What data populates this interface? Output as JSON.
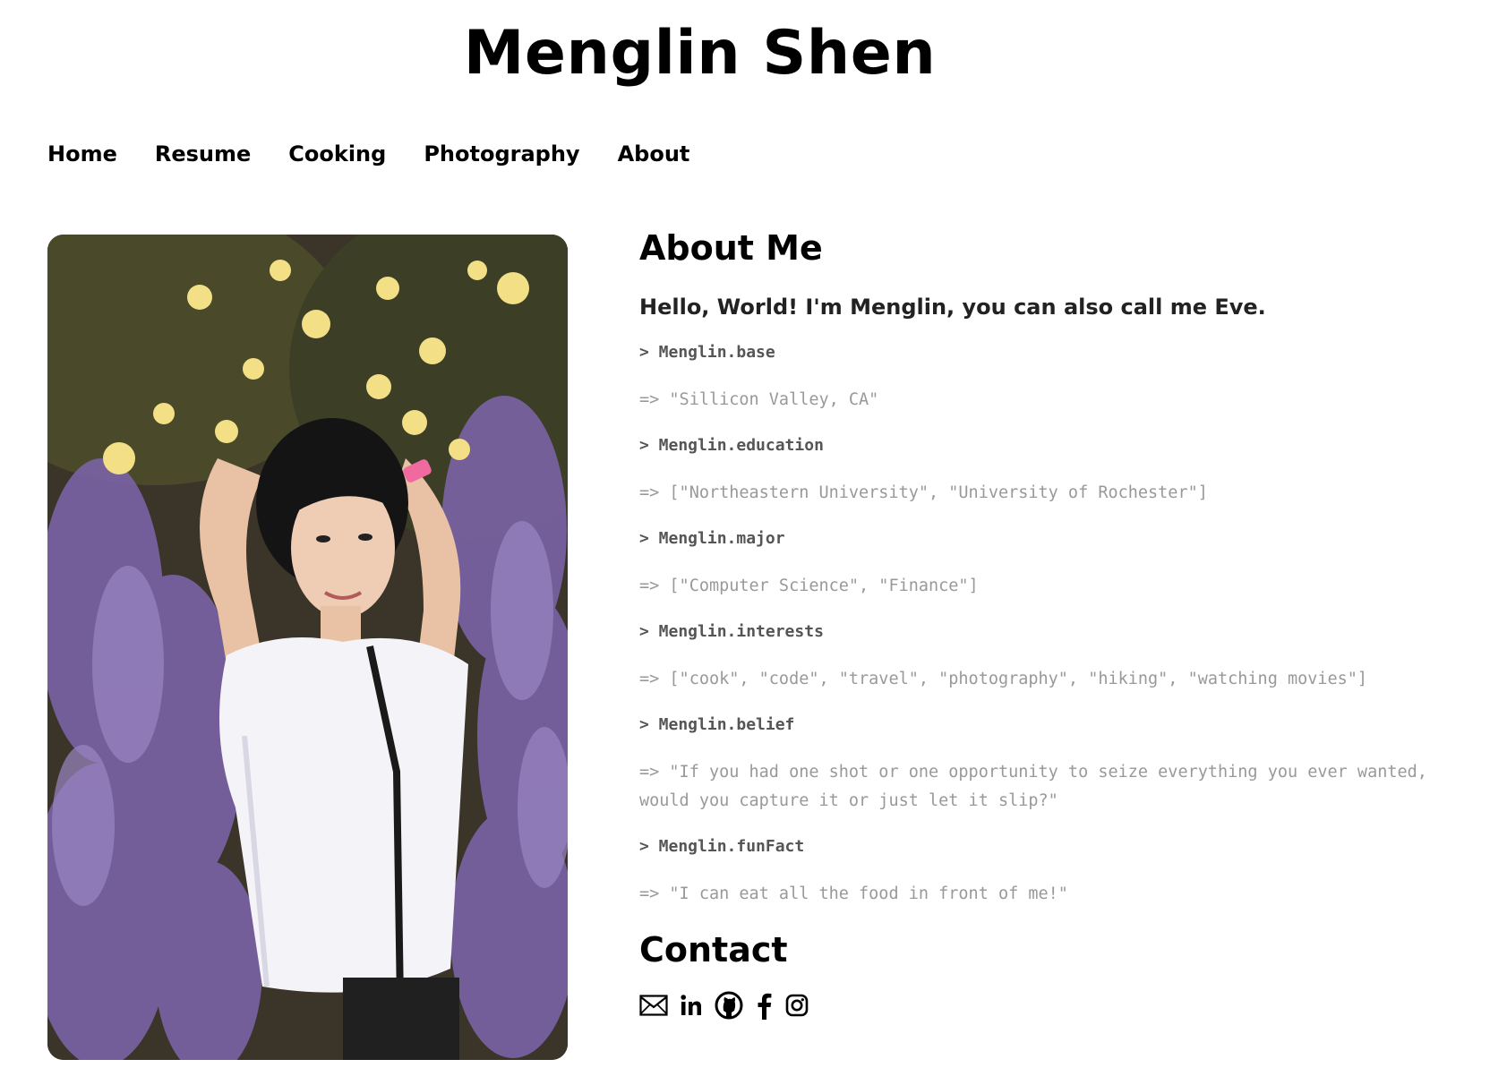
{
  "site": {
    "title": "Menglin Shen"
  },
  "nav": {
    "items": [
      {
        "label": "Home"
      },
      {
        "label": "Resume"
      },
      {
        "label": "Cooking"
      },
      {
        "label": "Photography"
      },
      {
        "label": "About"
      }
    ]
  },
  "about": {
    "heading": "About Me",
    "greeting": "Hello, World! I'm Menglin, you can also call me Eve.",
    "entries": [
      {
        "cmd": "> Menglin.base",
        "out": "=> \"Sillicon Valley, CA\""
      },
      {
        "cmd": "> Menglin.education",
        "out": "=> [\"Northeastern University\", \"University of Rochester\"]"
      },
      {
        "cmd": "> Menglin.major",
        "out": "=> [\"Computer Science\", \"Finance\"]"
      },
      {
        "cmd": "> Menglin.interests",
        "out": "=> [\"cook\", \"code\", \"travel\", \"photography\", \"hiking\", \"watching movies\"]"
      },
      {
        "cmd": "> Menglin.belief",
        "out": "=> \"If you had one shot or one opportunity to seize everything you ever wanted, would you capture it or just let it slip?\""
      },
      {
        "cmd": "> Menglin.funFact",
        "out": "=> \"I can eat all the food in front of me!\""
      }
    ]
  },
  "contact": {
    "heading": "Contact",
    "icons": [
      "email-icon",
      "linkedin-icon",
      "github-icon",
      "facebook-icon",
      "instagram-icon"
    ]
  }
}
